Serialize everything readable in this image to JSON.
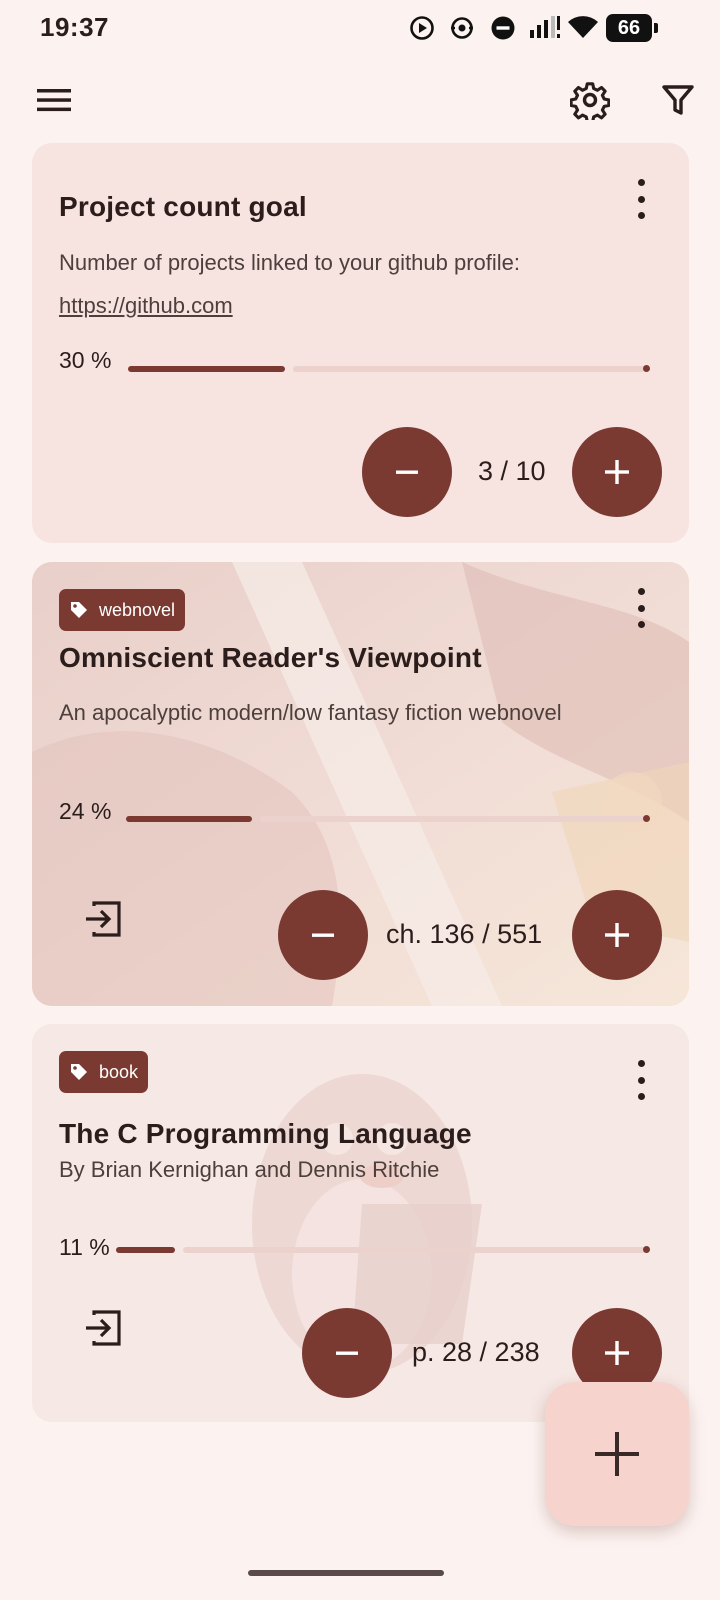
{
  "status_bar": {
    "time": "19:37",
    "battery": "66",
    "icons": [
      "play-circle-icon",
      "sync-icon",
      "do-not-disturb-icon",
      "signal-icon",
      "wifi-icon",
      "battery-icon"
    ]
  },
  "top_bar": {
    "icons": [
      "menu-icon",
      "settings-icon",
      "filter-icon"
    ]
  },
  "cards": [
    {
      "title": "Project count goal",
      "description_prefix": "Number of projects linked to your github profile: ",
      "description_link": "https://github.com",
      "percent_label": "30 %",
      "progress": 0.3,
      "counter": "3 / 10"
    },
    {
      "tag": "webnovel",
      "title": "Omniscient Reader's Viewpoint",
      "description": "An apocalyptic modern/low fantasy fiction webnovel",
      "percent_label": "24 %",
      "progress": 0.24,
      "counter": "ch. 136 / 551"
    },
    {
      "tag": "book",
      "title": "The C Programming Language",
      "description": "By Brian Kernighan and Dennis Ritchie",
      "percent_label": "11 %",
      "progress": 0.11,
      "counter": "p. 28 / 238"
    }
  ],
  "colors": {
    "background": "#fcf3f1",
    "card": "#f7e3e0",
    "accent": "#7a3a32",
    "track": "#ecd2cd",
    "fab": "#f6d3cd"
  }
}
